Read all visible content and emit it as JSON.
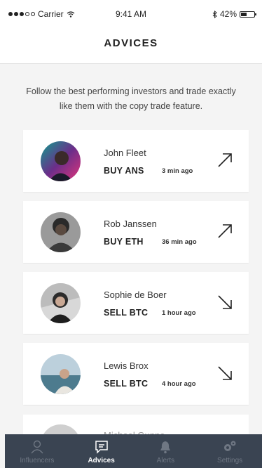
{
  "status_bar": {
    "carrier": "Carrier",
    "time": "9:41 AM",
    "battery": "42%",
    "battery_level": 0.42
  },
  "header": {
    "title": "ADVICES"
  },
  "intro": "Follow the best performing investors and trade exactly like them with the copy trade feature.",
  "advices": [
    {
      "name": "John Fleet",
      "action": "BUY ANS",
      "time": "3 min ago",
      "direction": "up"
    },
    {
      "name": "Rob Janssen",
      "action": "BUY ETH",
      "time": "36 min ago",
      "direction": "up"
    },
    {
      "name": "Sophie de Boer",
      "action": "SELL BTC",
      "time": "1 hour ago",
      "direction": "down"
    },
    {
      "name": "Lewis Brox",
      "action": "SELL BTC",
      "time": "4 hour ago",
      "direction": "down"
    }
  ],
  "partial_advice": {
    "name": "Michael Gunne"
  },
  "tabbar": {
    "tabs": [
      {
        "label": "Influencers",
        "icon": "person-icon",
        "active": false
      },
      {
        "label": "Advices",
        "icon": "chat-icon",
        "active": true
      },
      {
        "label": "Alerts",
        "icon": "bell-icon",
        "active": false
      },
      {
        "label": "Settings",
        "icon": "gears-icon",
        "active": false
      }
    ]
  }
}
